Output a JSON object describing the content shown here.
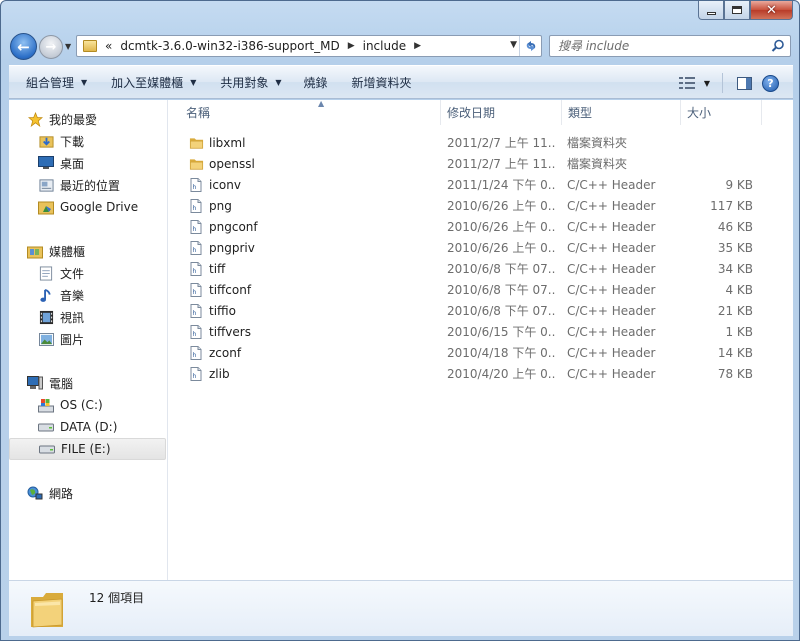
{
  "window": {
    "caption_buttons": [
      "minimize",
      "maximize",
      "close"
    ]
  },
  "address_bar": {
    "overflow": "«",
    "segments": [
      "dcmtk-3.6.0-win32-i386-support_MD",
      "include"
    ]
  },
  "search": {
    "placeholder": "搜尋 include"
  },
  "toolbar": {
    "organize": "組合管理",
    "include_in_library": "加入至媒體櫃",
    "share_with": "共用對象",
    "burn": "燒錄",
    "new_folder": "新增資料夾"
  },
  "nav_pane": {
    "favorites": {
      "label": "我的最愛",
      "items": [
        "下載",
        "桌面",
        "最近的位置",
        "Google Drive"
      ]
    },
    "libraries": {
      "label": "媒體櫃",
      "items": [
        "文件",
        "音樂",
        "視訊",
        "圖片"
      ]
    },
    "computer": {
      "label": "電腦",
      "items": [
        "OS (C:)",
        "DATA (D:)",
        "FILE (E:)"
      ]
    },
    "network": {
      "label": "網路"
    }
  },
  "columns": {
    "name": "名稱",
    "date": "修改日期",
    "type": "類型",
    "size": "大小"
  },
  "files": [
    {
      "name": "libxml",
      "date": "2011/2/7 上午 11...",
      "type": "檔案資料夾",
      "size": "",
      "icon": "folder-icon"
    },
    {
      "name": "openssl",
      "date": "2011/2/7 上午 11...",
      "type": "檔案資料夾",
      "size": "",
      "icon": "folder-icon"
    },
    {
      "name": "iconv",
      "date": "2011/1/24 下午 0...",
      "type": "C/C++ Header",
      "size": "9 KB",
      "icon": "header-file-icon"
    },
    {
      "name": "png",
      "date": "2010/6/26 上午 0...",
      "type": "C/C++ Header",
      "size": "117 KB",
      "icon": "header-file-icon"
    },
    {
      "name": "pngconf",
      "date": "2010/6/26 上午 0...",
      "type": "C/C++ Header",
      "size": "46 KB",
      "icon": "header-file-icon"
    },
    {
      "name": "pngpriv",
      "date": "2010/6/26 上午 0...",
      "type": "C/C++ Header",
      "size": "35 KB",
      "icon": "header-file-icon"
    },
    {
      "name": "tiff",
      "date": "2010/6/8 下午 07...",
      "type": "C/C++ Header",
      "size": "34 KB",
      "icon": "header-file-icon"
    },
    {
      "name": "tiffconf",
      "date": "2010/6/8 下午 07...",
      "type": "C/C++ Header",
      "size": "4 KB",
      "icon": "header-file-icon"
    },
    {
      "name": "tiffio",
      "date": "2010/6/8 下午 07...",
      "type": "C/C++ Header",
      "size": "21 KB",
      "icon": "header-file-icon"
    },
    {
      "name": "tiffvers",
      "date": "2010/6/15 下午 0...",
      "type": "C/C++ Header",
      "size": "1 KB",
      "icon": "header-file-icon"
    },
    {
      "name": "zconf",
      "date": "2010/4/18 下午 0...",
      "type": "C/C++ Header",
      "size": "14 KB",
      "icon": "header-file-icon"
    },
    {
      "name": "zlib",
      "date": "2010/4/20 上午 0...",
      "type": "C/C++ Header",
      "size": "78 KB",
      "icon": "header-file-icon"
    }
  ],
  "details": {
    "item_count": "12 個項目"
  }
}
